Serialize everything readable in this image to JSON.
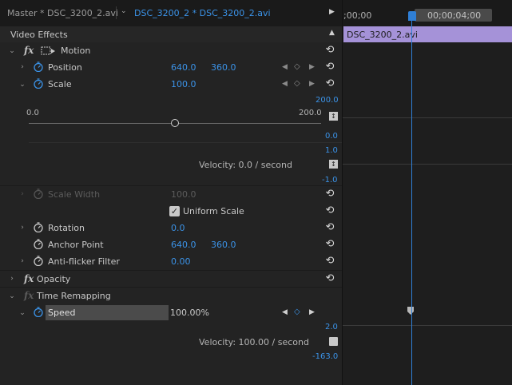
{
  "tabs": {
    "master": "Master * DSC_3200_2.avi",
    "active": "DSC_3200_2 * DSC_3200_2.avi"
  },
  "timeline": {
    "start_time": ";00;00",
    "marker_time": "00;00;04;00",
    "clip_name": "DSC_3200_2.avi"
  },
  "panel": {
    "title": "Video Effects"
  },
  "motion": {
    "label": "Motion",
    "position": {
      "label": "Position",
      "x": "640.0",
      "y": "360.0"
    },
    "scale": {
      "label": "Scale",
      "value": "100.0",
      "slider_min": "0.0",
      "slider_max": "200.0",
      "slider_fraction": 0.5,
      "graph_top": "200.0",
      "graph_bottom": "0.0",
      "velocity_top": "1.0",
      "velocity_label": "Velocity: 0.0 / second",
      "velocity_bottom": "-1.0"
    },
    "scale_width": {
      "label": "Scale Width",
      "value": "100.0"
    },
    "uniform_scale": {
      "label": "Uniform Scale",
      "checked": true
    },
    "rotation": {
      "label": "Rotation",
      "value": "0.0"
    },
    "anchor_point": {
      "label": "Anchor Point",
      "x": "640.0",
      "y": "360.0"
    },
    "anti_flicker": {
      "label": "Anti-flicker Filter",
      "value": "0.00"
    }
  },
  "opacity": {
    "label": "Opacity"
  },
  "time_remapping": {
    "label": "Time Remapping",
    "speed": {
      "label": "Speed",
      "value": "100.00%",
      "graph_top": "2.0",
      "velocity_label": "Velocity: 100.00 / second",
      "graph_bottom": "-163.0"
    }
  },
  "colors": {
    "accent_blue": "#3b93e8",
    "clip_purple": "#a592d8",
    "playhead": "#2f7fd6"
  }
}
